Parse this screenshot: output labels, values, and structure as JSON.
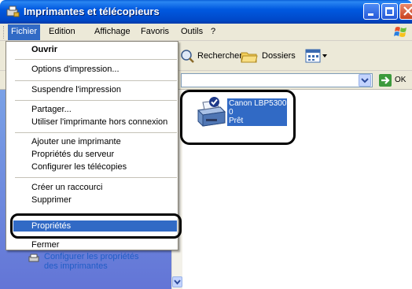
{
  "window": {
    "title": "Imprimantes et télécopieurs"
  },
  "menubar": {
    "items": [
      "Fichier",
      "Edition",
      "Affichage",
      "Favoris",
      "Outils",
      "?"
    ]
  },
  "toolbar": {
    "search_label": "Rechercher",
    "folders_label": "Dossiers"
  },
  "addressbar": {
    "go_label": "OK"
  },
  "file_menu": {
    "items": [
      "Ouvrir",
      "Options d'impression...",
      "Suspendre l'impression",
      "Partager...",
      "Utiliser l'imprimante hors connexion",
      "Ajouter une imprimante",
      "Propriétés du serveur",
      "Configurer les télécopies",
      "Créer un raccourci",
      "Supprimer",
      "Propriétés",
      "Fermer"
    ]
  },
  "tasks": {
    "link_line1": "Configurer les propriétés",
    "link_line2": "des imprimantes"
  },
  "printer": {
    "name": "Canon LBP5300",
    "documents": "0",
    "status": "Prêt"
  },
  "colors": {
    "title_blue": "#0054e3",
    "selection_blue": "#316ac5",
    "menubar_bg": "#ece9d8"
  }
}
